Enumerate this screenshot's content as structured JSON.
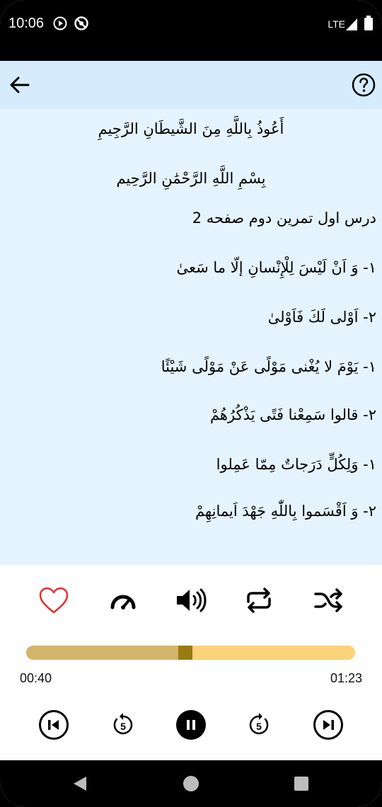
{
  "status_bar": {
    "time": "10:06",
    "network": "LTE",
    "icons": [
      "play-circle-icon",
      "no-sync-icon",
      "signal-icon",
      "battery-icon"
    ]
  },
  "app_bar": {
    "back_icon": "arrow-left-icon",
    "help_icon": "question-circle-icon"
  },
  "content": {
    "lines": [
      "أَعُوذُ بِاللَّهِ مِنَ الشَّيطَانِ الرَّجِيمِ",
      "بِسْمِ اللَّهِ الرَّحْمَٰنِ الرَّحِيم",
      "درس اول تمرین دوم صفحه 2",
      "١- وَ اَنْ لَيْسَ لِلْإِنْسانِ إلّا ما سَعىٰ",
      "٢- اَوْلی لَكَ فَاَوْلىٰ",
      "١- يَوْمَ لا يُغْنی مَوْلًى عَنْ مَوْلًى شَيْئًا",
      "٢- قالوا سَمِعْنا فَتًى يَذْكُرُهُمْ",
      "١- وَلِكُلٍّ دَرَجاتٌ مِمّا عَمِلوا",
      "٢- وَ اَقْسَموا بِاللّٰهِ جَهْدَ اَيمانِهِمْ"
    ]
  },
  "player": {
    "controls": [
      "heart-icon",
      "speedometer-icon",
      "volume-icon",
      "repeat-icon",
      "shuffle-icon"
    ],
    "elapsed": "00:40",
    "duration": "01:23",
    "progress_fraction": 0.48,
    "transport": [
      "skip-previous-icon",
      "replay-5-icon",
      "pause-icon",
      "forward-5-icon",
      "skip-next-icon"
    ],
    "replay_seconds": "5",
    "forward_seconds": "5"
  },
  "colors": {
    "app_bar": "#d6ecfd",
    "content_bg": "#e5f3fe",
    "progress_track": "#fad27a",
    "progress_played": "#d2b46b",
    "progress_thumb": "#9a7a12",
    "heart": "#e03030"
  },
  "nav_bar": {
    "buttons": [
      "back-triangle-icon",
      "home-circle-icon",
      "recents-square-icon"
    ]
  }
}
